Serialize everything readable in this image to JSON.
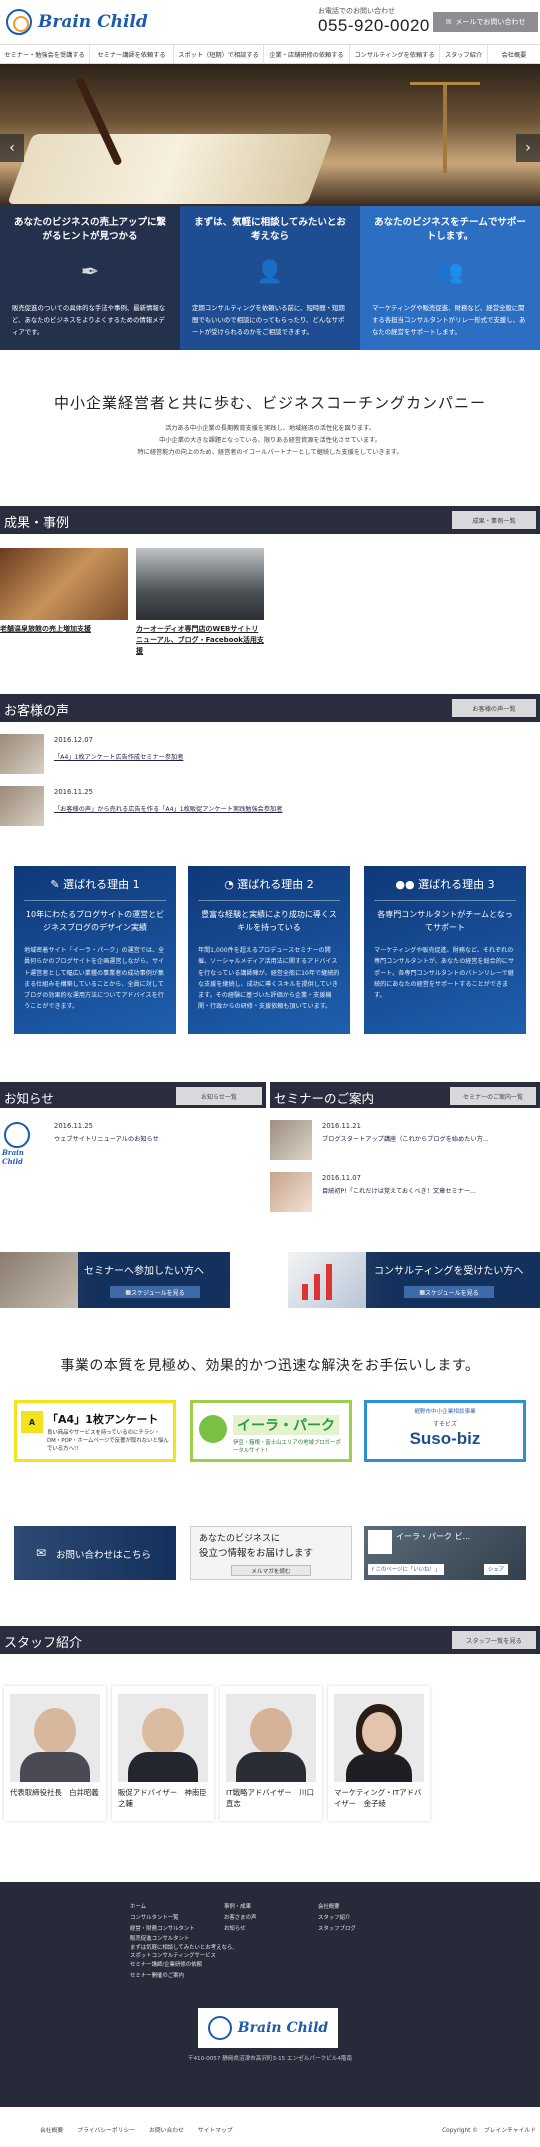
{
  "header": {
    "logo": "Brain Child",
    "phone_label": "お電話でのお問い合わせ",
    "phone": "055-920-0020",
    "mail_button": "メールでお問い合わせ"
  },
  "nav": [
    "セミナー・勉強会を受講する",
    "セミナー講師を依頼する",
    "スポット（短期）で相談する",
    "企業・店舗研修の依頼する",
    "コンサルティングを依頼する",
    "スタッフ紹介",
    "会社概要"
  ],
  "features": [
    {
      "title": "あなたのビジネスの売上アップに繋がるヒントが見つかる",
      "text": "販売促進のついての具体的な手法や事例、最新情報など、あなたのビジネスをよりよくするための情報メディアです。",
      "color": "#23314d"
    },
    {
      "title": "まずは、気軽に相談してみたいとお考えなら",
      "text": "定期コンサルティングを依頼いる前に、短時間・短期間でもいいので相談にのってもらったり、どんなサポートが受けられるのかをご相談できます。",
      "color": "#1f4d92"
    },
    {
      "title": "あなたのビジネスをチームでサポートします。",
      "text": "マーケティングや販売促進、財務など、経営全般に関する各担当コンサルタントがリレー形式で支援し、あなたの経営をサポートします。",
      "color": "#2c6fc2"
    }
  ],
  "lead": {
    "title": "中小企業経営者と共に歩む、ビジネスコーチングカンパニー",
    "lines": [
      "活力ある中小企業の長期教育支援を実践し、地域経済の活性化を図ります。",
      "中小企業の大きな課題となっている、限りある経営資源を活性化させています。",
      "特に経営能力の向上のため、経営者のイコールパートナーとして継続した支援をしていきます。"
    ]
  },
  "cases": {
    "title": "成果・事例",
    "button": "成果・事例一覧",
    "items": [
      "老舗温泉旅館の売上増加支援",
      "カーオーディオ専門店のWEBサイトリニューアル、ブログ・Facebook活用支援"
    ]
  },
  "voices": {
    "title": "お客様の声",
    "button": "お客様の声一覧",
    "items": [
      {
        "date": "2016.12.07",
        "text": "「A4」1枚アンケート広告作成セミナー参加者"
      },
      {
        "date": "2016.11.25",
        "text": "「お客様の声」から売れる広告を作る「A4」1枚販促アンケート実践勉強会参加者"
      }
    ]
  },
  "reasons": [
    {
      "title": "選ばれる理由 1",
      "sub": "10年にわたるブログサイトの運営とビジネスブログのデザイン実績",
      "text": "地域密着サイト「イーラ・パーク」の運営では、全員何らかのブログサイトを企画運営しながら、サイト運営者として幅広い業種の事業者の成功事例が集まる仕組みを構築していることから、全員に対してブログの効果的な運用方法についてアドバイスを行うことができます。"
    },
    {
      "title": "選ばれる理由 2",
      "sub": "豊富な経験と実績により成功に導くスキルを持っている",
      "text": "年間1,000件を超えるプロデュースセミナーの開催、ソーシャルメディア活用法に関するアドバイスを行なっている講師陣が、経営全般に10年で継続的な支援を継続し、成功に導くスキルを提供していきます。その経験に基づいた評価から企業・支援機関・行政からの研修・支援依頼も頂いています。"
    },
    {
      "title": "選ばれる理由 3",
      "sub": "各専門コンサルタントがチームとなってサポート",
      "text": "マーケティングや販売促進、財務など、それぞれの専門コンサルタントが、あなたの経営を総合的にサポート。各専門コンサルタントのバトンリレーで継続的にあなたの経営をサポートすることができます。"
    }
  ],
  "news": {
    "title": "お知らせ",
    "button": "お知らせ一覧",
    "items": [
      {
        "date": "2016.11.25",
        "text": "ウェブサイトリニューアルのお知らせ"
      }
    ]
  },
  "seminars": {
    "title": "セミナーのご案内",
    "button": "セミナーのご案内一覧",
    "items": [
      {
        "date": "2016.11.21",
        "text": "ブログスタートアップ講座（これからブログを始めたい方..."
      },
      {
        "date": "2016.11.07",
        "text": "目続初P!「これだけは覚えておくべき！文章セミナー..."
      }
    ]
  },
  "banners": [
    {
      "title": "セミナーへ参加したい方へ",
      "sub": "スケジュールを見る"
    },
    {
      "title": "コンサルティングを受けたい方へ",
      "sub": "スケジュールを見る"
    }
  ],
  "tagline": "事業の本質を見極め、効果的かつ迅速な解決をお手伝いします。",
  "links": [
    {
      "title": "「A4」1枚アンケート",
      "sub": "良い商品やサービスを持っているのにチラシ・DM・POP・ホームページで反響が取れないと悩んでいる方へ!!"
    },
    {
      "title": "イーラ・パーク",
      "sub": "伊豆・箱根・富士山エリアの地域ブロガーポータルサイト!"
    },
    {
      "title": "Suso-biz",
      "sub": "裾野市中小企業相談事業",
      "ruby": "すそビズ"
    }
  ],
  "banner2": {
    "contact": "お問い合わせはこちら",
    "info1": "あなたのビジネスに",
    "info2": "役立つ情報をお届けします",
    "info_sub": "メルマガを読む",
    "fb": "イーラ・パーク ビ...",
    "fb_like": "このページに「いいね！」",
    "fb_share": "シェア"
  },
  "staff": {
    "title": "スタッフ紹介",
    "button": "スタッフ一覧を見る",
    "members": [
      "代表取締役社長　白井昭義",
      "販促アドバイザー　神南臣之輔",
      "IT戦略アドバイザー　川口直志",
      "マーケティング・ITアドバイザー　金子綾"
    ]
  },
  "footer": {
    "col1": [
      "ホーム",
      "コンサルタント一覧",
      "経営・財務コンサルタント",
      "販売促進コンサルタント",
      "まずは気軽に相談してみたいとお考えなら、スポットコンサルティングサービス",
      "セミナー講師/企業研修の依頼",
      "セミナー開催のご案内"
    ],
    "col2": [
      "事例・成果",
      "お客さまの声",
      "お知らせ"
    ],
    "col3": [
      "会社概要",
      "スタッフ紹介",
      "スタッフブログ"
    ],
    "logo": "Brain Child",
    "address": "〒410-0057 静岡県沼津市高沢町3-15 エンゼルパークビル4階南"
  },
  "bottom": {
    "links": [
      "会社概要",
      "プライバシーポリシー",
      "お問い合わせ",
      "サイトマップ"
    ],
    "copyright": "Copyright ©　ブレインチャイルド"
  }
}
